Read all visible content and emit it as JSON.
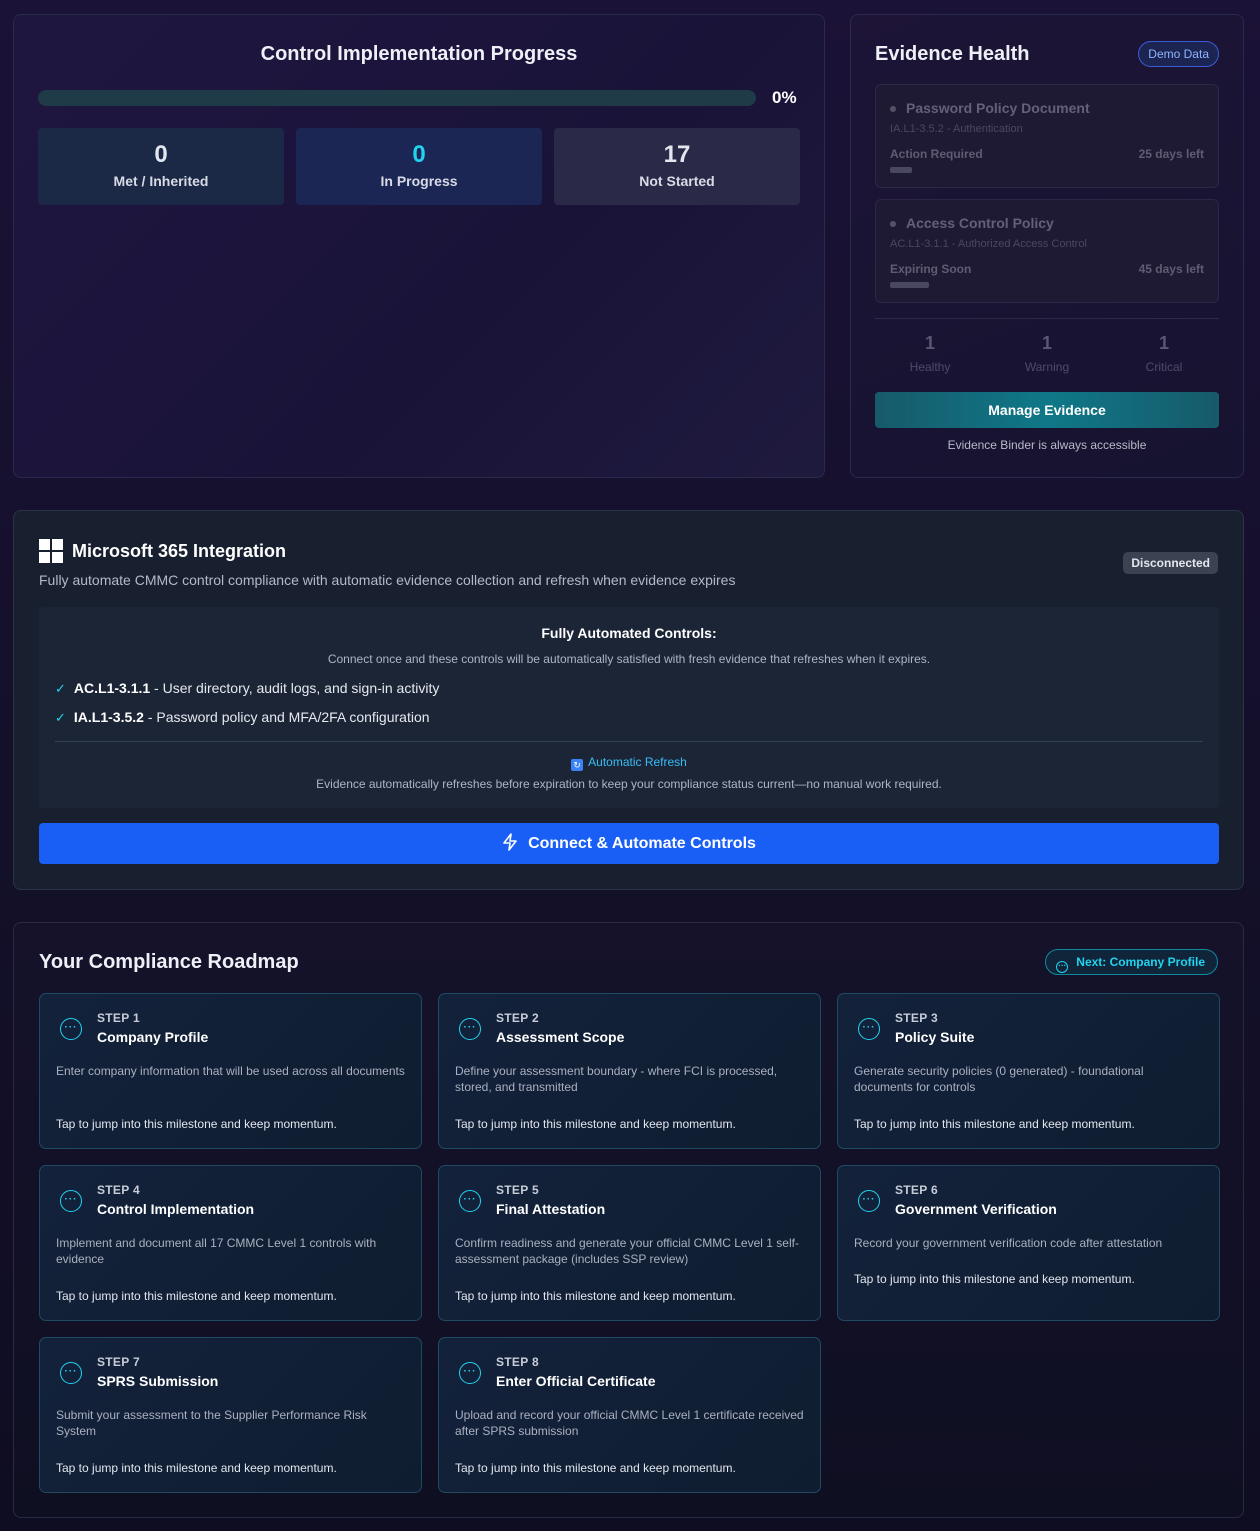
{
  "progress": {
    "title": "Control Implementation Progress",
    "percent": 0,
    "percent_label": "0%",
    "stats": [
      {
        "value": "0",
        "label": "Met / Inherited"
      },
      {
        "value": "0",
        "label": "In Progress"
      },
      {
        "value": "17",
        "label": "Not Started"
      }
    ]
  },
  "evidence": {
    "title": "Evidence Health",
    "badge": "Demo Data",
    "items": [
      {
        "name": "Password Policy Document",
        "control": "IA.L1-3.5.2 - Authentication",
        "status": "Action Required",
        "days": "25 days left"
      },
      {
        "name": "Access Control Policy",
        "control": "AC.L1-3.1.1 - Authorized Access Control",
        "status": "Expiring Soon",
        "days": "45 days left"
      }
    ],
    "counts": [
      {
        "value": "1",
        "label": "Healthy"
      },
      {
        "value": "1",
        "label": "Warning"
      },
      {
        "value": "1",
        "label": "Critical"
      }
    ],
    "manage_button": "Manage Evidence",
    "footer": "Evidence Binder is always accessible"
  },
  "m365": {
    "title": "Microsoft 365 Integration",
    "description": "Fully automate CMMC control compliance with automatic evidence collection and refresh when evidence expires",
    "status_badge": "Disconnected",
    "box_title": "Fully Automated Controls:",
    "box_subtitle": "Connect once and these controls will be automatically satisfied with fresh evidence that refreshes when it expires.",
    "controls": [
      {
        "check": "✓",
        "id": "AC.L1-3.1.1",
        "text": " - User directory, audit logs, and sign-in activity"
      },
      {
        "check": "✓",
        "id": "IA.L1-3.5.2",
        "text": " - Password policy and MFA/2FA configuration"
      }
    ],
    "refresh_title": "Automatic Refresh",
    "refresh_desc": "Evidence automatically refreshes before expiration to keep your compliance status current—no manual work required.",
    "connect_button": "Connect & Automate Controls"
  },
  "roadmap": {
    "title": "Your Compliance Roadmap",
    "next_badge": "Next: Company Profile",
    "tap_text": "Tap to jump into this milestone and keep momentum.",
    "steps": [
      {
        "step": "STEP 1",
        "name": "Company Profile",
        "desc": "Enter company information that will be used across all documents"
      },
      {
        "step": "STEP 2",
        "name": "Assessment Scope",
        "desc": "Define your assessment boundary - where FCI is processed, stored, and transmitted"
      },
      {
        "step": "STEP 3",
        "name": "Policy Suite",
        "desc": "Generate security policies (0 generated) - foundational documents for controls"
      },
      {
        "step": "STEP 4",
        "name": "Control Implementation",
        "desc": "Implement and document all 17 CMMC Level 1 controls with evidence"
      },
      {
        "step": "STEP 5",
        "name": "Final Attestation",
        "desc": "Confirm readiness and generate your official CMMC Level 1 self-assessment package (includes SSP review)"
      },
      {
        "step": "STEP 6",
        "name": "Government Verification",
        "desc": "Record your government verification code after attestation"
      },
      {
        "step": "STEP 7",
        "name": "SPRS Submission",
        "desc": "Submit your assessment to the Supplier Performance Risk System"
      },
      {
        "step": "STEP 8",
        "name": "Enter Official Certificate",
        "desc": "Upload and record your official CMMC Level 1 certificate received after SPRS submission"
      }
    ]
  }
}
